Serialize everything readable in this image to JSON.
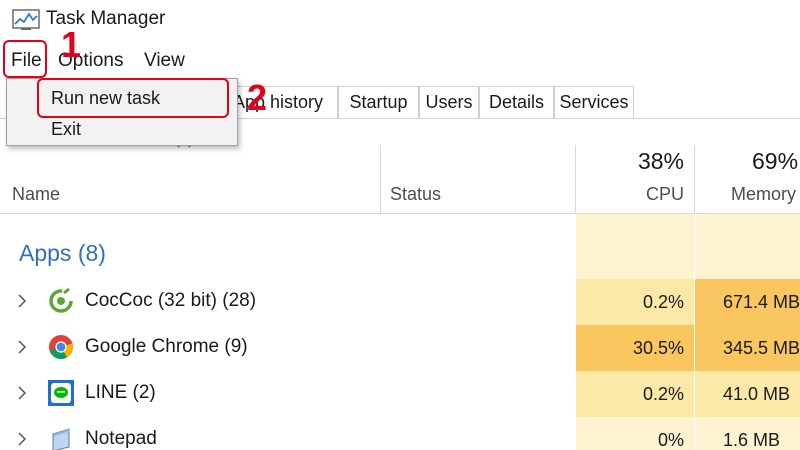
{
  "window": {
    "title": "Task Manager",
    "app_icon": "task-manager-icon"
  },
  "menubar": {
    "items": [
      "File",
      "Options",
      "View"
    ]
  },
  "tabs": [
    "App history",
    "Startup",
    "Users",
    "Details",
    "Services"
  ],
  "file_menu": {
    "items": [
      "Run new task",
      "Exit"
    ]
  },
  "columns": {
    "name": "Name",
    "status": "Status",
    "cpu": {
      "percent": "38%",
      "label": "CPU"
    },
    "memory": {
      "percent": "69%",
      "label": "Memory"
    }
  },
  "group": {
    "label": "Apps (8)"
  },
  "rows": [
    {
      "name": "CocCoc (32 bit) (28)",
      "icon": "coccoc-icon",
      "cpu": "0.2%",
      "memory": "671.4 MB",
      "cpu_load": 0.2
    },
    {
      "name": "Google Chrome (9)",
      "icon": "chrome-icon",
      "cpu": "30.5%",
      "memory": "345.5 MB",
      "cpu_load": 30.5
    },
    {
      "name": "LINE (2)",
      "icon": "line-icon",
      "cpu": "0.2%",
      "memory": "41.0 MB",
      "cpu_load": 0.2
    },
    {
      "name": "Notepad",
      "icon": "notepad-icon",
      "cpu": "0%",
      "memory": "1.6 MB",
      "cpu_load": 0
    }
  ],
  "annotations": [
    "1",
    "2"
  ],
  "colors": {
    "annotation_red": "#e2001a",
    "group_blue": "#2f6fbf",
    "heat_light": "#fdf3d0",
    "heat_medium": "#fce9a8",
    "heat_high": "#f9c660"
  }
}
